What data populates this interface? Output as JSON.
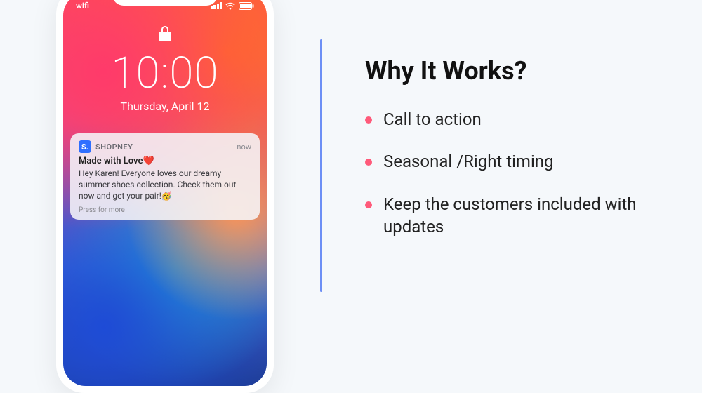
{
  "phone": {
    "status": {
      "wifi_label": "wifi"
    },
    "lock_screen": {
      "time": "10:00",
      "date": "Thursday, April 12"
    },
    "notification": {
      "app_badge": "S.",
      "app_name": "SHOPNEY",
      "time": "now",
      "title": "Made with Love❤️",
      "body": "Hey Karen! Everyone loves our dreamy summer shoes collection. Check them out now and get your pair!🥳",
      "footer": "Press for more"
    }
  },
  "content": {
    "heading": "Why It Works?",
    "bullets": [
      "Call to action",
      "Seasonal /Right timing",
      "Keep the customers included with updates"
    ]
  }
}
